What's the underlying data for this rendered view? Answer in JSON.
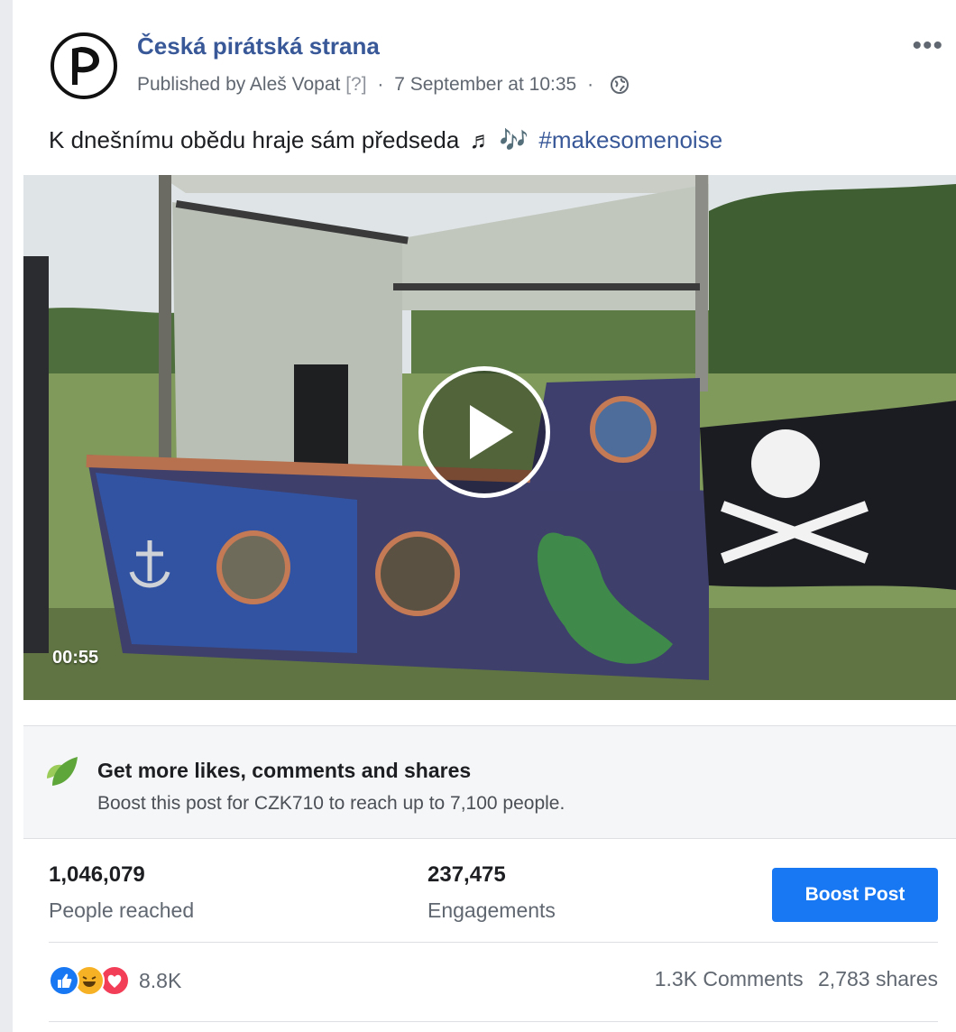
{
  "post": {
    "page_name": "Česká pirátská strana",
    "published_by": "Published by Aleš Vopat",
    "help_marker": "[?]",
    "date": "7 September at 10:35",
    "text": "K dnešnímu obědu hraje sám předseda",
    "notes": "♬ 🎶",
    "hashtag": "#makesomenoise"
  },
  "video": {
    "duration": "00:55"
  },
  "boost_promo": {
    "title": "Get more likes, comments and shares",
    "subtitle": "Boost this post for CZK710 to reach up to 7,100 people."
  },
  "insights": {
    "people_reached_value": "1,046,079",
    "people_reached_label": "People reached",
    "engagements_value": "237,475",
    "engagements_label": "Engagements",
    "boost_button": "Boost Post"
  },
  "social": {
    "reactions_count": "8.8K",
    "comments": "1.3K Comments",
    "shares": "2,783 shares"
  },
  "colors": {
    "link_blue": "#385898",
    "boost_blue": "#1877f2",
    "leaf_green": "#7bc043"
  }
}
